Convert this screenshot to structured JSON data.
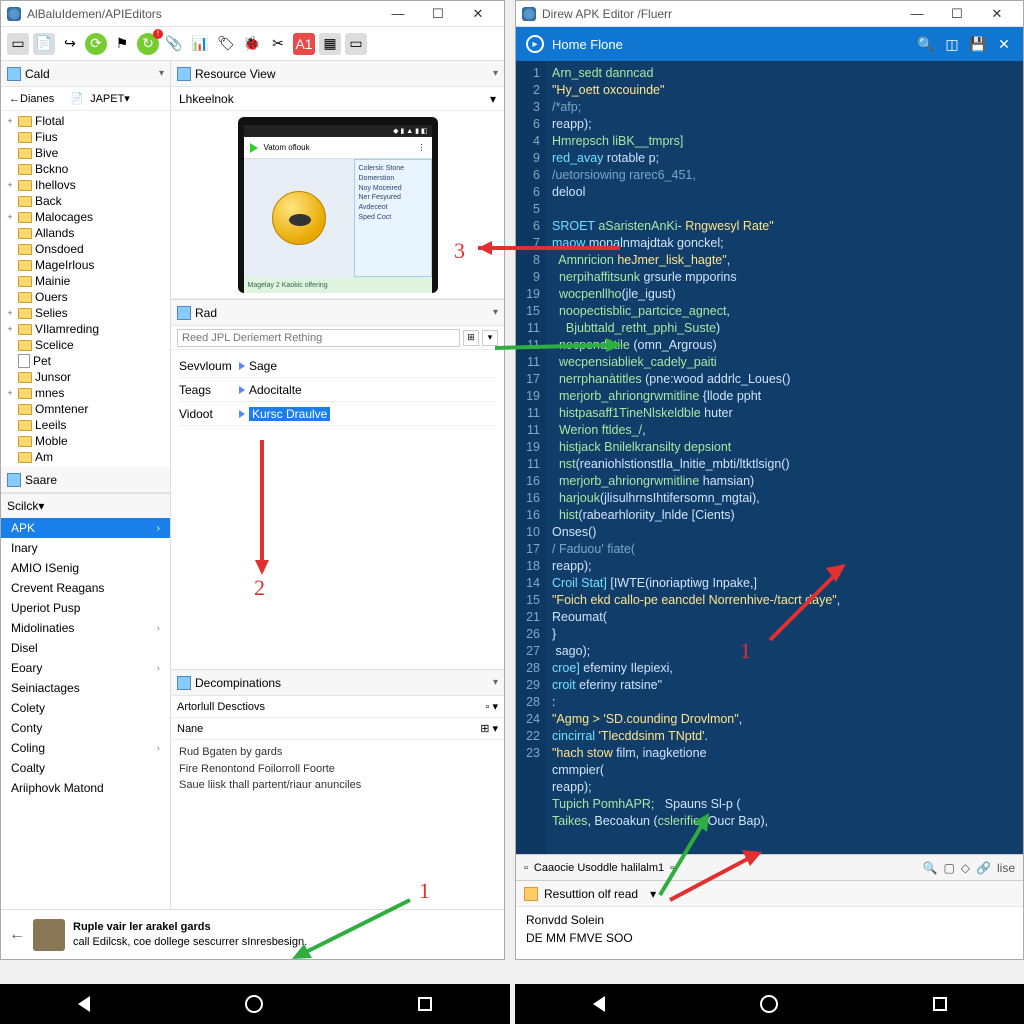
{
  "left_window": {
    "title": "AlBaluIdemen/APIEditors",
    "cald_header": "Cald",
    "tabs": {
      "dianes": "Dianes",
      "japet": "JAPET"
    },
    "tree": [
      {
        "t": "+",
        "k": "fld",
        "l": "Flotal"
      },
      {
        "t": "",
        "k": "fld",
        "l": "Fius"
      },
      {
        "t": "",
        "k": "fld",
        "l": "Bive"
      },
      {
        "t": "",
        "k": "fld",
        "l": "Bckno"
      },
      {
        "t": "+",
        "k": "fld",
        "l": "Ihellovs"
      },
      {
        "t": "",
        "k": "fld",
        "l": "Back"
      },
      {
        "t": "+",
        "k": "fld",
        "l": "Malocages"
      },
      {
        "t": "",
        "k": "fld",
        "l": "Allands"
      },
      {
        "t": "",
        "k": "fld",
        "l": "Onsdoed"
      },
      {
        "t": "",
        "k": "fld",
        "l": "MageIrlous"
      },
      {
        "t": "",
        "k": "fld",
        "l": "Mainie"
      },
      {
        "t": "",
        "k": "fld",
        "l": "Ouers"
      },
      {
        "t": "+",
        "k": "fld",
        "l": "Selies"
      },
      {
        "t": "+",
        "k": "fld",
        "l": "VIlamreding"
      },
      {
        "t": "",
        "k": "fld",
        "l": "Scelice"
      },
      {
        "t": "",
        "k": "file",
        "l": "Pet"
      },
      {
        "t": "",
        "k": "fld",
        "l": "Junsor"
      },
      {
        "t": "+",
        "k": "fld",
        "l": "mnes"
      },
      {
        "t": "",
        "k": "fld",
        "l": "Omntener"
      },
      {
        "t": "",
        "k": "fld",
        "l": "Leeils"
      },
      {
        "t": "",
        "k": "fld",
        "l": "Moble"
      },
      {
        "t": "",
        "k": "fld",
        "l": "Am"
      }
    ],
    "saare": "Saare",
    "scilck": "Scilck",
    "side_list": [
      {
        "l": "APK",
        "sel": true,
        "chv": true
      },
      {
        "l": "Inary"
      },
      {
        "l": "AMIO ISenig"
      },
      {
        "l": "Crevent Reagans"
      },
      {
        "l": "Uperiot Pusp"
      },
      {
        "l": "Midolinaties",
        "chv": true
      },
      {
        "l": "Disel"
      },
      {
        "l": "Eoary",
        "chv": true
      },
      {
        "l": "Seiniactages"
      },
      {
        "l": "Colety"
      },
      {
        "l": "Conty"
      },
      {
        "l": "Coling",
        "chv": true
      },
      {
        "l": "Coalty"
      },
      {
        "l": "Ariiphovk Matond"
      }
    ],
    "resource_view": "Resource View",
    "rv_sub": "Lhkeelnok",
    "phone": {
      "appbar": "Vatom oflouk",
      "card_lines": [
        "Colersic Stone",
        "Domerstion",
        "Noy Moceired",
        "Ner Fesyured",
        "Avdeceot",
        "Sped Coct"
      ],
      "bottom": "Magelay 2 Kaokic olfering"
    },
    "rad": {
      "header": "Rad",
      "search_ph": "Reed JPL Deriemert Rething",
      "rows": [
        {
          "lbl": "Sevvloum",
          "val": "Sage"
        },
        {
          "lbl": "Teags",
          "val": "Adocitalte"
        },
        {
          "lbl": "Vidoot",
          "val": "Kursc Draulve",
          "sel": true
        }
      ]
    },
    "decomp": {
      "header": "Decompinations",
      "sub": "Artorlull Desctiovs",
      "col": "Nane",
      "lines": [
        "Rud Bgaten by gards",
        "Fire Renontond Foilorroll Foorte",
        "Saue liisk thall partent/riaur anunciles"
      ]
    },
    "footer": {
      "t1": "Ruple vair ler arakel gards",
      "t2": "call Edilcsk, coe dollege sescurrer sInresbesign."
    }
  },
  "right_window": {
    "title": "Direw APK Editor /Fluerr",
    "homebar": "Home Flone",
    "gutter": [
      "1",
      "2",
      "3",
      "6",
      "4",
      "9",
      "6",
      "6",
      "5",
      "6",
      "7",
      "8",
      "9",
      "19",
      "15",
      "11",
      "11",
      "11",
      "17",
      "19",
      "11",
      "11",
      "19",
      "11",
      "16",
      "16",
      "16",
      "10",
      "17",
      "18",
      "14",
      "15",
      "21",
      "26",
      "27",
      "28",
      "29",
      "28",
      "24",
      "22",
      "23",
      "",
      "",
      ""
    ],
    "code_lines": [
      "<span class='fn'>Arn_sedt danncad</span>",
      "<span class='str'>\"Hy_oett oxcouinde\"</span>",
      "<span class='cm'>/*afp;</span>",
      "reapp);",
      "<span class='fn'>Hmrepsch liBK__tmprs]</span>",
      "<span class='kw'>red_avay</span> rotable p;",
      "<span class='cm'>/uetorsiowing rarec6_451,</span>",
      "delool",
      "",
      "<span class='kw'>SROET</span> <span class='fn'>aSaristenAnKi</span>- <span class='str'>Rngwesyl Rate\"</span>",
      "<span class='kw'>maow</span> monalnmajdtak gonckel;",
      "  <span class='fn'>Amnricion</span> <span class='str'>heJmer_lisk_hagte\"</span>,",
      "  <span class='fn'>nerpihaffitsunk</span> grsurle mpporins",
      "  <span class='fn'>wocpenllho</span>(jle_igust)",
      "  <span class='fn'>noopectisblic_partcice_agnect</span>,",
      "    <span class='fn'>Bjubttald_retht_pphi_Suste</span>)",
      "  <span class='fn'>nocpendotile</span> (omn_Argrous)",
      "  <span class='fn'>wecpensiabliek_cadely_paiti</span>",
      "  <span class='fn'>nerrphanàtitles</span> (pne:wood addrlc_Loues()",
      "  <span class='fn'>merjorb_ahriongrwmitline</span> {llode ppht",
      "  <span class='fn'>histpasaff1TineNlskeldble</span> huter",
      "  <span class='fn'>Werion ftldes_/</span>,",
      "  <span class='fn'>histjack Bnilelkransilty depsiont</span>",
      "  <span class='fn'>nst</span>(reaniohlstionstlla_lnitie_mbti/ltktlsign()",
      "  <span class='fn'>merjorb_ahriongrwmitline</span> hamsian)",
      "  <span class='fn'>harjouk</span>(jlisulhrnsIhtifersomn_mgtai),",
      "  <span class='fn'>hist</span>(rabearhloriity_lnlde [Cients)",
      "Onses()",
      "<span class='cm'>/ Faduou' fiate(</span>",
      "reapp);",
      "<span class='kw'>Croil Stat]</span> [IWTE(inoriaptiwg Inpake,]",
      "<span class='str'>\"Foich ekd callo-pe eancdel Norrenhive-/tacrt daye\"</span>,",
      "Reoumat(",
      "}",
      "&nbsp;sago);",
      "<span class='kw'>croe]</span> efeminy Ilepiexi,",
      "<span class='kw'>croit</span> eferiny ratsine\"",
      ":",
      "<span class='str'>\"Agmg &gt; 'SD.counding Drovlmon\"</span>,",
      "<span class='kw'>cincirral</span> <span class='str'>'Tlecddsinm TNptd'</span>.",
      "<span class='str'>\"hach stow</span> film, inagketione",
      "cmmpier(",
      "reapp);",
      "<span class='fn'>Tupich PomhAPR;</span>   Spauns Sl-p (",
      "<span class='fn'>Taikes</span>, Becoakun (<span class='fn'>cslerifier</span> Oucr Bap),"
    ],
    "lowbar": "Caaocie Usoddle halilalm1",
    "lowbar_end": "lise",
    "result": {
      "header": "Resuttion olf read",
      "l1": "Ronvdd Solein",
      "l2": "DE MM FMVE SOO"
    }
  },
  "annotations": {
    "n1_left": "1",
    "n2": "2",
    "n3": "3",
    "n1_right": "1"
  }
}
